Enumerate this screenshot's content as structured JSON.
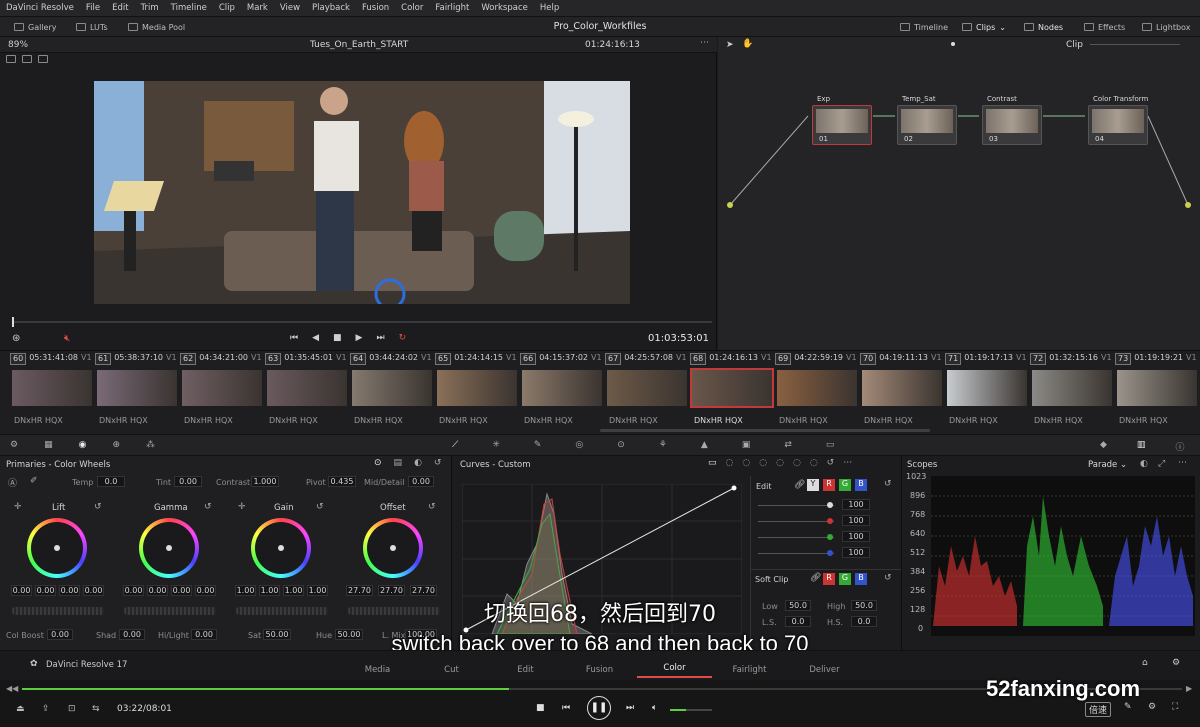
{
  "menu": [
    "DaVinci Resolve",
    "File",
    "Edit",
    "Trim",
    "Timeline",
    "Clip",
    "Mark",
    "View",
    "Playback",
    "Fusion",
    "Color",
    "Fairlight",
    "Workspace",
    "Help"
  ],
  "toolbar": {
    "gallery": "Gallery",
    "luts": "LUTs",
    "media_pool": "Media Pool",
    "project_title": "Pro_Color_Workfiles",
    "timeline": "Timeline",
    "clips": "Clips",
    "nodes": "Nodes",
    "effects": "Effects",
    "lightbox": "Lightbox"
  },
  "viewer": {
    "zoom": "89%",
    "timeline_name": "Tues_On_Earth_START",
    "timecode": "01:24:16:13",
    "playhead_tc": "01:03:53:01"
  },
  "node_editor": {
    "mode": "Clip",
    "nodes": [
      {
        "label": "Exp",
        "num": "01"
      },
      {
        "label": "Temp_Sat",
        "num": "02"
      },
      {
        "label": "Contrast",
        "num": "03"
      },
      {
        "label": "Color Transform",
        "num": "04"
      }
    ]
  },
  "clips": [
    {
      "n": "60",
      "tc": "05:31:41:08",
      "track": "V1",
      "codec": "DNxHR HQX"
    },
    {
      "n": "61",
      "tc": "05:38:37:10",
      "track": "V1",
      "codec": "DNxHR HQX"
    },
    {
      "n": "62",
      "tc": "04:34:21:00",
      "track": "V1",
      "codec": "DNxHR HQX"
    },
    {
      "n": "63",
      "tc": "01:35:45:01",
      "track": "V1",
      "codec": "DNxHR HQX"
    },
    {
      "n": "64",
      "tc": "03:44:24:02",
      "track": "V1",
      "codec": "DNxHR HQX"
    },
    {
      "n": "65",
      "tc": "01:24:14:15",
      "track": "V1",
      "codec": "DNxHR HQX"
    },
    {
      "n": "66",
      "tc": "04:15:37:02",
      "track": "V1",
      "codec": "DNxHR HQX"
    },
    {
      "n": "67",
      "tc": "04:25:57:08",
      "track": "V1",
      "codec": "DNxHR HQX"
    },
    {
      "n": "68",
      "tc": "01:24:16:13",
      "track": "V1",
      "codec": "DNxHR HQX"
    },
    {
      "n": "69",
      "tc": "04:22:59:19",
      "track": "V1",
      "codec": "DNxHR HQX"
    },
    {
      "n": "70",
      "tc": "04:19:11:13",
      "track": "V1",
      "codec": "DNxHR HQX"
    },
    {
      "n": "71",
      "tc": "01:19:17:13",
      "track": "V1",
      "codec": "DNxHR HQX"
    },
    {
      "n": "72",
      "tc": "01:32:15:16",
      "track": "V1",
      "codec": "DNxHR HQX"
    },
    {
      "n": "73",
      "tc": "01:19:19:21",
      "track": "V1",
      "codec": "DNxHR HQX"
    }
  ],
  "primaries": {
    "title": "Primaries - Color Wheels",
    "temp_label": "Temp",
    "temp": "0.0",
    "tint_label": "Tint",
    "tint": "0.00",
    "contrast_label": "Contrast",
    "contrast": "1.000",
    "pivot_label": "Pivot",
    "pivot": "0.435",
    "middetail_label": "Mid/Detail",
    "middetail": "0.00",
    "wheels": [
      {
        "name": "Lift",
        "vals": [
          "0.00",
          "0.00",
          "0.00",
          "0.00"
        ]
      },
      {
        "name": "Gamma",
        "vals": [
          "0.00",
          "0.00",
          "0.00",
          "0.00"
        ]
      },
      {
        "name": "Gain",
        "vals": [
          "1.00",
          "1.00",
          "1.00",
          "1.00"
        ]
      },
      {
        "name": "Offset",
        "vals": [
          "27.70",
          "27.70",
          "27.70"
        ]
      }
    ],
    "colboost_label": "Col Boost",
    "colboost": "0.00",
    "shad_label": "Shad",
    "shad": "0.00",
    "hilight_label": "Hi/Light",
    "hilight": "0.00",
    "sat_label": "Sat",
    "sat": "50.00",
    "hue_label": "Hue",
    "hue": "50.00",
    "lmix_label": "L. Mix",
    "lmix": "100.00"
  },
  "curves": {
    "title": "Curves - Custom",
    "edit_label": "Edit",
    "channels": [
      "Y",
      "R",
      "G",
      "B"
    ],
    "edit_vals": [
      "100",
      "100",
      "100",
      "100"
    ],
    "softclip_label": "Soft Clip",
    "low_label": "Low",
    "low": "50.0",
    "high_label": "High",
    "high": "50.0",
    "ls_label": "L.S.",
    "ls": "0.0",
    "hs_label": "H.S.",
    "hs": "0.0"
  },
  "scopes": {
    "title": "Scopes",
    "mode": "Parade",
    "ticks": [
      "1023",
      "896",
      "768",
      "640",
      "512",
      "384",
      "256",
      "128",
      "0"
    ]
  },
  "pages": [
    "Media",
    "Cut",
    "Edit",
    "Fusion",
    "Color",
    "Fairlight",
    "Deliver"
  ],
  "app_name": "DaVinci Resolve 17",
  "player": {
    "time": "03:22/08:01",
    "speed_label": "倍速",
    "progress": 0.42
  },
  "subtitles": {
    "cn": "切换回68，然后回到70",
    "en": "switch back over to 68 and then back to 70"
  },
  "watermark": "52fanxing.com",
  "colors": {
    "accent": "#e04b4b",
    "node_selected": "#c0393b",
    "progress": "#5ccf3c"
  }
}
